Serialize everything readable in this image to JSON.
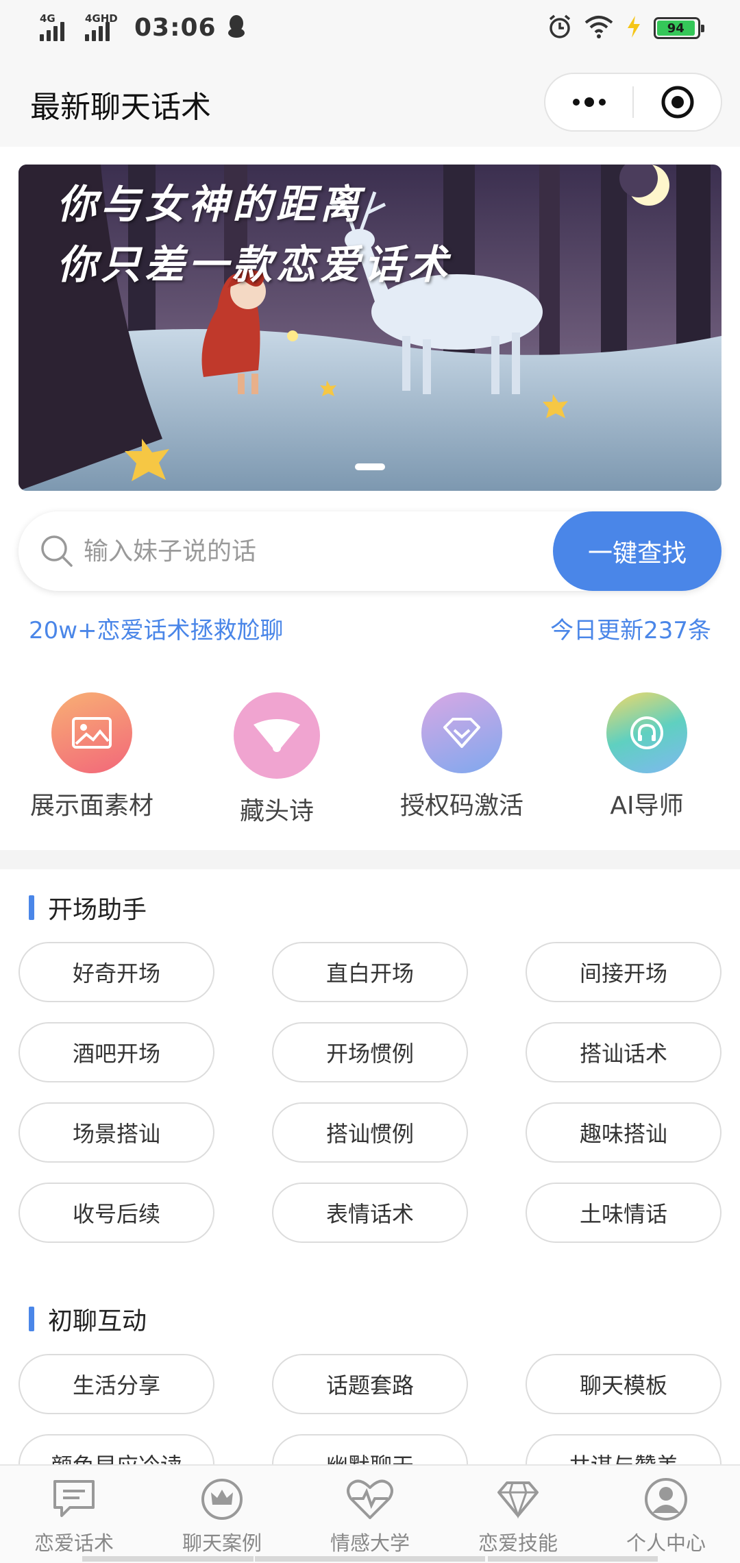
{
  "status_bar": {
    "network_left": "4G",
    "network_right": "4GHD",
    "time": "03:06",
    "battery": "94"
  },
  "nav": {
    "title": "最新聊天话术"
  },
  "banner": {
    "line1": "你与女神的距离",
    "line2": "你只差一款恋爱话术"
  },
  "search": {
    "placeholder": "输入妹子说的话",
    "button_label": "一键查找"
  },
  "promo": {
    "left": "20w+恋爱话术拯救尬聊",
    "right": "今日更新237条"
  },
  "features": [
    {
      "label": "展示面素材",
      "icon": "image-icon",
      "color": "#f58a63"
    },
    {
      "label": "藏头诗",
      "icon": "fan-icon",
      "color": "#f0a4d0"
    },
    {
      "label": "授权码激活",
      "icon": "diamond-icon",
      "color": "#a9a8e8"
    },
    {
      "label": "AI导师",
      "icon": "headphones-icon",
      "color": "#6fd2b8"
    }
  ],
  "sections": [
    {
      "title": "开场助手",
      "tags": [
        "好奇开场",
        "直白开场",
        "间接开场",
        "酒吧开场",
        "开场惯例",
        "搭讪话术",
        "场景搭讪",
        "搭讪惯例",
        "趣味搭讪",
        "收号后续",
        "表情话术",
        "土味情话"
      ]
    },
    {
      "title": "初聊互动",
      "tags": [
        "生活分享",
        "话题套路",
        "聊天模板",
        "颜色早应冷读",
        "幽默聊天",
        "共谋与赞美"
      ]
    }
  ],
  "tabbar": [
    {
      "label": "恋爱话术",
      "icon": "chat-icon"
    },
    {
      "label": "聊天案例",
      "icon": "crown-icon"
    },
    {
      "label": "情感大学",
      "icon": "heart-pulse-icon"
    },
    {
      "label": "恋爱技能",
      "icon": "diamond-icon"
    },
    {
      "label": "个人中心",
      "icon": "person-icon"
    }
  ],
  "colors": {
    "accent": "#4a86e8",
    "battery": "#35c759"
  }
}
